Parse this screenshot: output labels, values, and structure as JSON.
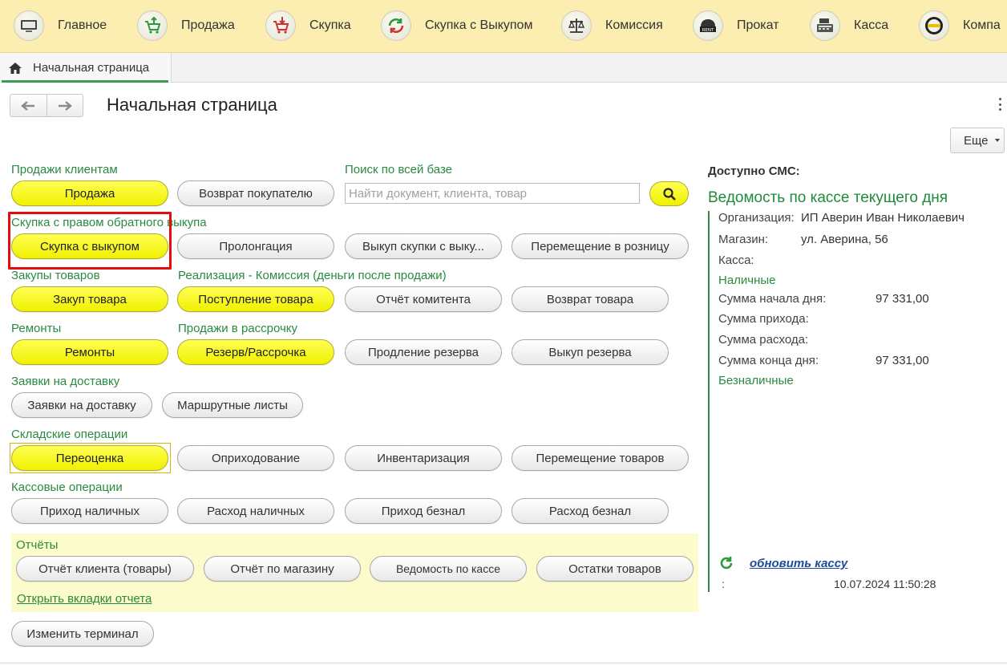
{
  "sections_bar": {
    "items": [
      {
        "label": "Главное",
        "icon": "computer-icon"
      },
      {
        "label": "Продажа",
        "icon": "cart-up-icon"
      },
      {
        "label": "Скупка",
        "icon": "cart-down-icon"
      },
      {
        "label": "Скупка с Выкупом",
        "icon": "cycle-arrows-icon"
      },
      {
        "label": "Комиссия",
        "icon": "scales-icon"
      },
      {
        "label": "Прокат",
        "icon": "rent-icon"
      },
      {
        "label": "Касса",
        "icon": "cash-register-icon"
      },
      {
        "label": "Компа",
        "icon": "company-logo-icon"
      }
    ]
  },
  "tabs": {
    "home_tab_label": "Начальная страница"
  },
  "header": {
    "title": "Начальная страница",
    "more_button": "Еще"
  },
  "groups": {
    "sales": {
      "label": "Продажи клиентам",
      "buttons": [
        "Продажа",
        "Возврат покупателю"
      ]
    },
    "search": {
      "label": "Поиск по всей базе",
      "placeholder": "Найти документ, клиента, товар",
      "value": ""
    },
    "buyback": {
      "label": "Скупка с правом обратного выкупа",
      "buttons": [
        "Скупка с выкупом",
        "Пролонгация",
        "Выкуп скупки с выку...",
        "Перемещение в розницу"
      ]
    },
    "purchases": {
      "label": "Закупы товаров",
      "buttons": [
        "Закуп товара"
      ]
    },
    "commission": {
      "label": "Реализация - Комиссия (деньги после продажи)",
      "buttons": [
        "Поступление товара",
        "Отчёт комитента",
        "Возврат товара"
      ]
    },
    "repairs": {
      "label": "Ремонты",
      "buttons": [
        "Ремонты"
      ]
    },
    "installments": {
      "label": "Продажи в рассрочку",
      "buttons": [
        "Резерв/Рассрочка",
        "Продление резерва",
        "Выкуп резерва"
      ]
    },
    "delivery": {
      "label": "Заявки на доставку",
      "buttons": [
        "Заявки на доставку",
        "Маршрутные листы"
      ]
    },
    "warehouse": {
      "label": "Складские операции",
      "buttons": [
        "Переоценка",
        "Оприходование",
        "Инвентаризация",
        "Перемещение товаров"
      ]
    },
    "cash": {
      "label": "Кассовые операции",
      "buttons": [
        "Приход наличных",
        "Расход наличных",
        "Приход безнал",
        "Расход безнал"
      ]
    },
    "reports": {
      "label": "Отчёты",
      "buttons": [
        "Отчёт клиента (товары)",
        "Отчёт по магазину",
        "Ведомость по кассе",
        "Остатки товаров"
      ],
      "open_tabs_link": "Открыть вкладки отчета"
    },
    "change_terminal": "Изменить терминал"
  },
  "right_panel": {
    "sms_label": "Доступно СМС:",
    "ledger_title": "Ведомость по кассе текущего дня",
    "org_label": "Организация:",
    "org_value": "ИП Аверин Иван Николаевич",
    "shop_label": "Магазин:",
    "shop_value": "ул. Аверина, 56",
    "cashbox_label": "Касса:",
    "cash_section": "Наличные",
    "start_sum_label": "Сумма начала дня:",
    "start_sum_value": "97 331,00",
    "income_label": "Сумма прихода:",
    "expense_label": "Сумма расхода:",
    "end_sum_label": "Сумма конца дня:",
    "end_sum_value": "97 331,00",
    "noncash_section": "Безналичные",
    "refresh_link": "обновить кассу",
    "updated_prefix": ":",
    "updated_at": "10.07.2024 11:50:28"
  },
  "colors": {
    "accent_green": "#2a8a3f",
    "button_yellow": "#f5f500",
    "top_bar": "#fbeeb0",
    "highlight_red": "#e01010",
    "reports_bg": "#fcfbcc"
  }
}
